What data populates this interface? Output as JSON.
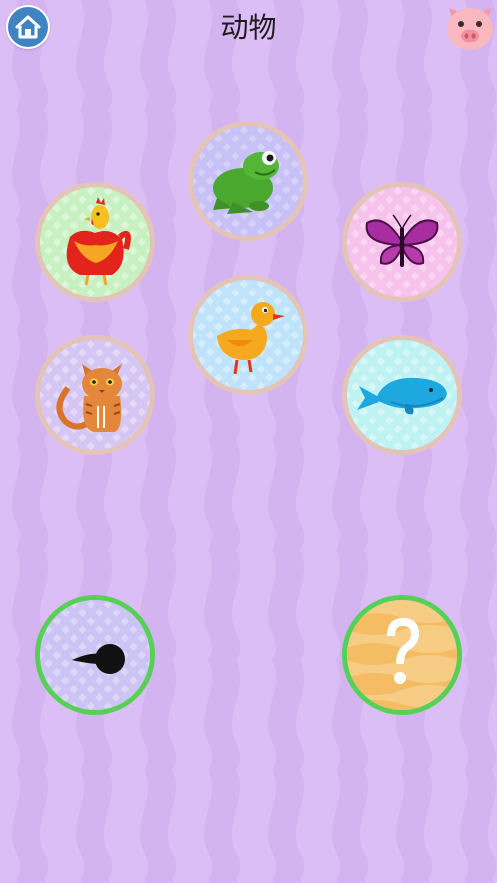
{
  "header": {
    "title": "动物",
    "home_icon": "home-icon",
    "profile_icon": "pig-face-icon"
  },
  "animals": [
    {
      "icon": "frog-icon",
      "bg_color": "#c8c1f6"
    },
    {
      "icon": "rooster-icon",
      "bg_color": "#c8f1c2"
    },
    {
      "icon": "butterfly-icon",
      "bg_color": "#f7c2ec"
    },
    {
      "icon": "duck-icon",
      "bg_color": "#bfe3fb"
    },
    {
      "icon": "cat-icon",
      "bg_color": "#d6c6f4"
    },
    {
      "icon": "whale-icon",
      "bg_color": "#bff2f2"
    }
  ],
  "bottom": [
    {
      "icon": "tadpole-icon",
      "bg_color": "#ccc4f5"
    },
    {
      "icon": "question-mark-icon",
      "bg_color": "#f7cd86"
    }
  ],
  "colors": {
    "background": "#dcbef6",
    "ring_default": "#e5c4b8",
    "ring_active": "#56d056"
  }
}
